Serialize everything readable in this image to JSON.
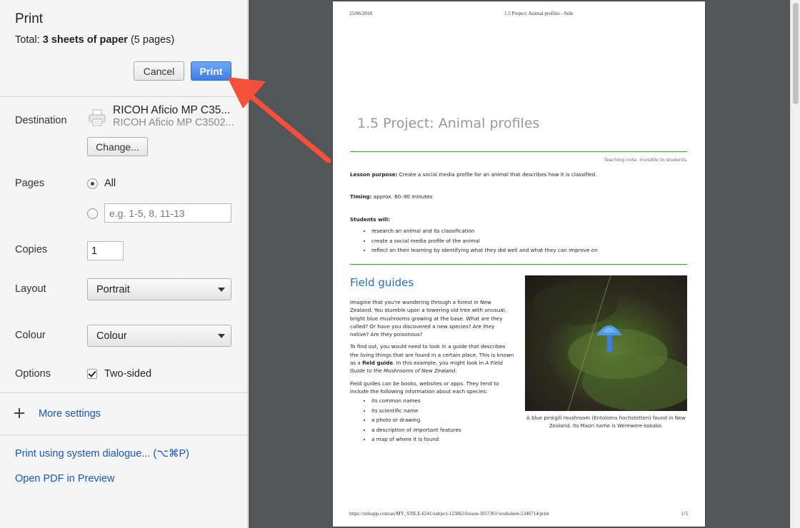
{
  "panel": {
    "title": "Print",
    "total_prefix": "Total: ",
    "total_bold": "3 sheets of paper",
    "total_suffix": " (5 pages)",
    "cancel_label": "Cancel",
    "print_label": "Print"
  },
  "destination": {
    "label": "Destination",
    "printer_name": "RICOH Aficio MP C35...",
    "printer_sub": "RICOH Aficio MP C3502...",
    "change_label": "Change..."
  },
  "pages": {
    "label": "Pages",
    "all_label": "All",
    "custom_placeholder": "e.g. 1-5, 8, 11-13"
  },
  "copies": {
    "label": "Copies",
    "value": "1"
  },
  "layout": {
    "label": "Layout",
    "value": "Portrait"
  },
  "colour": {
    "label": "Colour",
    "value": "Colour"
  },
  "options": {
    "label": "Options",
    "two_sided_label": "Two-sided",
    "two_sided_checked": true
  },
  "more_settings_label": "More settings",
  "links": {
    "system_dialogue": "Print using system dialogue... (⌥⌘P)",
    "open_pdf": "Open PDF in Preview"
  },
  "colors": {
    "accent": "#3d7de6",
    "link": "#1a55b8",
    "arrow": "#f4503a",
    "preview_bg": "#525659",
    "rule": "#3aa04a"
  },
  "preview": {
    "header_date": "25/06/2018",
    "header_title": "1.5 Project: Animal profiles - Stile",
    "doc_title": "1.5 Project: Animal profiles",
    "teaching_note": "Teaching note. Invisible to students.",
    "purpose_label": "Lesson purpose:",
    "purpose_text": " Create a social media profile for an animal that describes how it is classified.",
    "timing_label": "Timing:",
    "timing_text": " approx. 60–90 minutes",
    "students_will": "Students will:",
    "student_goals": [
      "research an animal and its classification",
      "create a social media profile of the animal",
      "reflect on their learning by identifying what they did well and what they can improve on"
    ],
    "field_heading": "Field guides",
    "para1": "Imagine that you're wandering through a forest in New Zealand. You stumble upon a towering old tree with unusual, bright blue mushrooms growing at the base. What are they called? Or have you discovered a new species? Are they native? Are they poisonous?",
    "para2_a": "To find out, you would need to look in a guide that describes the living things that are found in a certain place. This is known as a ",
    "para2_b": "field guide",
    "para2_c": ". In this example, you might look in ",
    "para2_d": "A Field Guide to the Mushrooms of New Zealand",
    "para2_e": ".",
    "para3": "Field guides can be books, websites or apps. They tend to include the following information about each species:",
    "field_list": [
      "its common names",
      "its scientific name",
      "a photo or drawing",
      "a description of important features",
      "a map of where it is found"
    ],
    "photo_caption": "A blue pinkgill mushroom (Entoloma hochstetteri) found in New Zealand. Its Maori name is Werewere-kokako.",
    "footer_url": "https://stileapp.com/au/MY_STILE-6241/subject-123862/lesson-1057361/worksheet-5346714/print",
    "footer_page": "1/5"
  }
}
